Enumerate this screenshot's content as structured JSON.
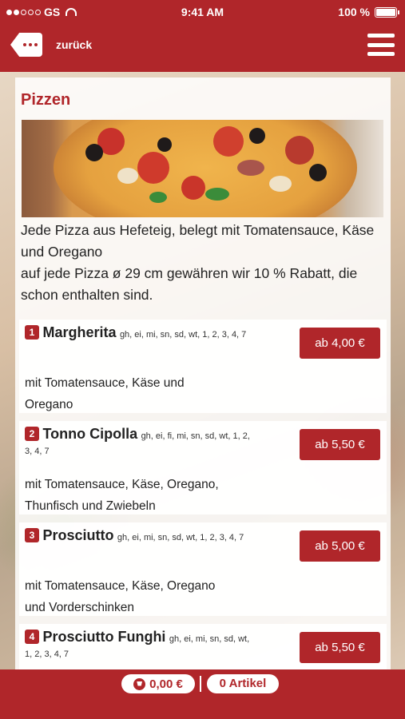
{
  "statusbar": {
    "carrier": "GS",
    "time": "9:41 AM",
    "battery": "100 %"
  },
  "navbar": {
    "back_label": "zurück"
  },
  "section": {
    "title": "Pizzen",
    "description_1": "Jede Pizza aus Hefeteig, belegt mit Tomatensauce, Käse und Oregano",
    "description_2": "auf jede Pizza ø 29 cm gewähren wir 10 % Rabatt, die schon enthalten sind."
  },
  "items": [
    {
      "number": "1",
      "name": "Margherita",
      "allergens": "gh, ei, mi, sn, sd, wt, 1, 2, 3, 4, 7",
      "price": "ab 4,00 €",
      "description": "mit Tomatensauce, Käse und Oregano"
    },
    {
      "number": "2",
      "name": "Tonno Cipolla",
      "allergens": "gh, ei, fi, mi, sn, sd, wt, 1, 2, 3, 4, 7",
      "price": "ab 5,50 €",
      "description": "mit Tomatensauce, Käse, Oregano, Thunfisch und Zwiebeln"
    },
    {
      "number": "3",
      "name": "Prosciutto",
      "allergens": "gh, ei, mi, sn, sd, wt, 1, 2, 3, 4, 7",
      "price": "ab 5,00 €",
      "description": "mit Tomatensauce, Käse, Oregano und Vorderschinken"
    },
    {
      "number": "4",
      "name": "Prosciutto Funghi",
      "allergens": "gh, ei, mi, sn, sd, wt, 1, 2, 3, 4, 7",
      "price": "ab 5,50 €",
      "description": ""
    }
  ],
  "footer": {
    "cart_total": "0,00 €",
    "item_count": "0 Artikel"
  },
  "colors": {
    "brand": "#b0262a"
  }
}
